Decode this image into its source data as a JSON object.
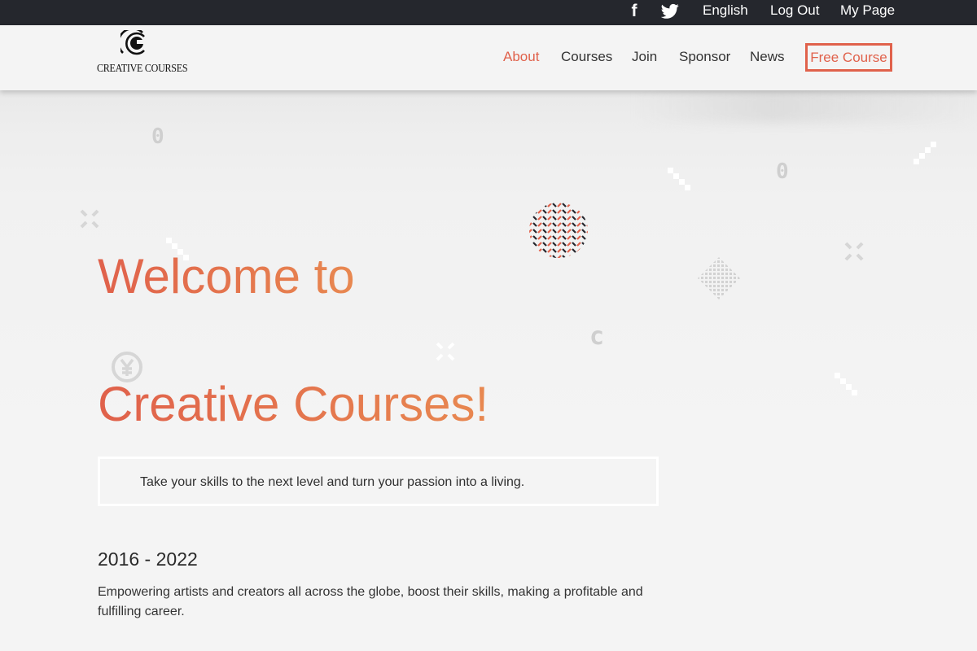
{
  "topbar": {
    "facebook_icon": "facebook-icon",
    "twitter_icon": "twitter-icon",
    "links": [
      "English",
      "Log Out",
      "My Page"
    ]
  },
  "logo": {
    "text": "CREATIVE COURSES"
  },
  "nav": {
    "items": [
      "About",
      "Courses",
      "Join",
      "Sponsor",
      "News"
    ],
    "active": "About",
    "cta": "Free Course"
  },
  "hero": {
    "title_line1": "Welcome to",
    "title_line2": "Creative Courses!",
    "tagline": "Take your skills to the next level and turn your passion into a living.",
    "years": "2016 - 2022",
    "description": "Empowering artists and creators all across the globe, boost their skills, making a profitable and fulfilling career."
  },
  "colors": {
    "accent": "#e0614b",
    "accent_end": "#e88850",
    "topbar": "#25272d",
    "background": "#f4f4f4"
  }
}
